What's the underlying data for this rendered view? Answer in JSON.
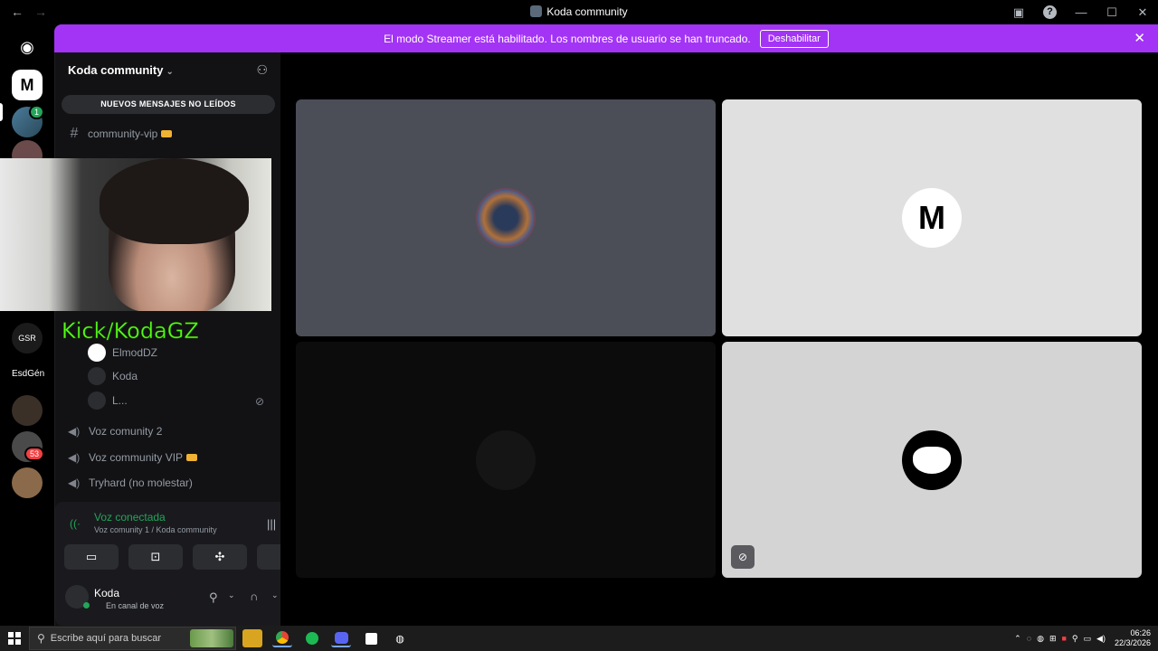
{
  "window": {
    "title": "Koda community",
    "back_glyph": "←",
    "forward_glyph": "→",
    "minimize": "—",
    "maximize": "☐",
    "close": "✕",
    "help": "?"
  },
  "banner": {
    "message": "El modo Streamer está habilitado. Los nombres de usuario se han truncado.",
    "button": "Deshabilitar",
    "close": "✕"
  },
  "servers": {
    "m_label": "M",
    "s5_label": "GSR",
    "s6_label": "EsdGén",
    "badge_green": "1",
    "badge_red": "53"
  },
  "sidebar": {
    "guild_name": "Koda community",
    "new_messages": "NUEVOS MENSAJES NO LEÍDOS",
    "text_channel": "community-vip",
    "stream_overlay": "Kick/KodaGZ",
    "voice_users": [
      "ElmodDZ",
      "Koda",
      "L..."
    ],
    "voice_channels": [
      "Voz comunity 2",
      "Voz community VIP",
      "Tryhard (no molestar)"
    ]
  },
  "voice_panel": {
    "status": "Voz conectada",
    "subtitle": "Voz comunity 1 ​/ Koda community",
    "user_name": "Koda",
    "user_status": "En canal de voz"
  },
  "taskbar": {
    "search_placeholder": "Escribe aquí para buscar",
    "time": "06:26",
    "date": "22/3/2026"
  },
  "colors": {
    "banner": "#a334f5",
    "connected": "#23a55a",
    "kick": "#53fc18"
  }
}
